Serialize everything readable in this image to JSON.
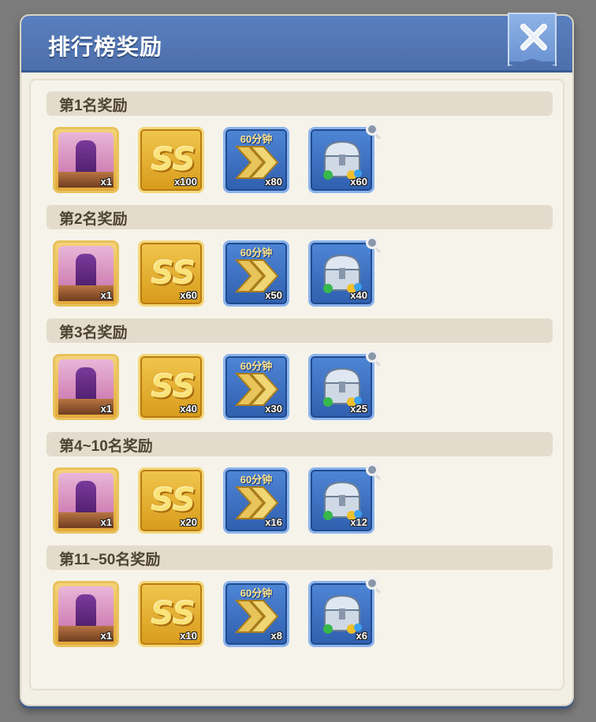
{
  "dialog": {
    "title": "排行榜奖励",
    "close_icon": "close-icon"
  },
  "tiers": [
    {
      "label": "第1名奖励",
      "rewards": [
        {
          "icon": "skin-portrait-icon",
          "qty": "x1"
        },
        {
          "icon": "ss-coupon-icon",
          "qty": "x100"
        },
        {
          "icon": "speedup-60min-icon",
          "timer": "60分钟",
          "qty": "x80"
        },
        {
          "icon": "silver-chest-icon",
          "qty": "x60"
        }
      ]
    },
    {
      "label": "第2名奖励",
      "rewards": [
        {
          "icon": "skin-portrait-icon",
          "qty": "x1"
        },
        {
          "icon": "ss-coupon-icon",
          "qty": "x60"
        },
        {
          "icon": "speedup-60min-icon",
          "timer": "60分钟",
          "qty": "x50"
        },
        {
          "icon": "silver-chest-icon",
          "qty": "x40"
        }
      ]
    },
    {
      "label": "第3名奖励",
      "rewards": [
        {
          "icon": "skin-portrait-icon",
          "qty": "x1"
        },
        {
          "icon": "ss-coupon-icon",
          "qty": "x40"
        },
        {
          "icon": "speedup-60min-icon",
          "timer": "60分钟",
          "qty": "x30"
        },
        {
          "icon": "silver-chest-icon",
          "qty": "x25"
        }
      ]
    },
    {
      "label": "第4~10名奖励",
      "rewards": [
        {
          "icon": "skin-portrait-icon",
          "qty": "x1"
        },
        {
          "icon": "ss-coupon-icon",
          "qty": "x20"
        },
        {
          "icon": "speedup-60min-icon",
          "timer": "60分钟",
          "qty": "x16"
        },
        {
          "icon": "silver-chest-icon",
          "qty": "x12"
        }
      ]
    },
    {
      "label": "第11~50名奖励",
      "rewards": [
        {
          "icon": "skin-portrait-icon",
          "qty": "x1"
        },
        {
          "icon": "ss-coupon-icon",
          "qty": "x10"
        },
        {
          "icon": "speedup-60min-icon",
          "timer": "60分钟",
          "qty": "x8"
        },
        {
          "icon": "silver-chest-icon",
          "qty": "x6"
        }
      ]
    }
  ],
  "ss_text": "SS",
  "colors": {
    "header": "#5a7fbe",
    "panel": "#f2efe4",
    "tier_bar": "#e3dccc",
    "gold_item": "#e0ad2c",
    "blue_item": "#3f73c4"
  }
}
